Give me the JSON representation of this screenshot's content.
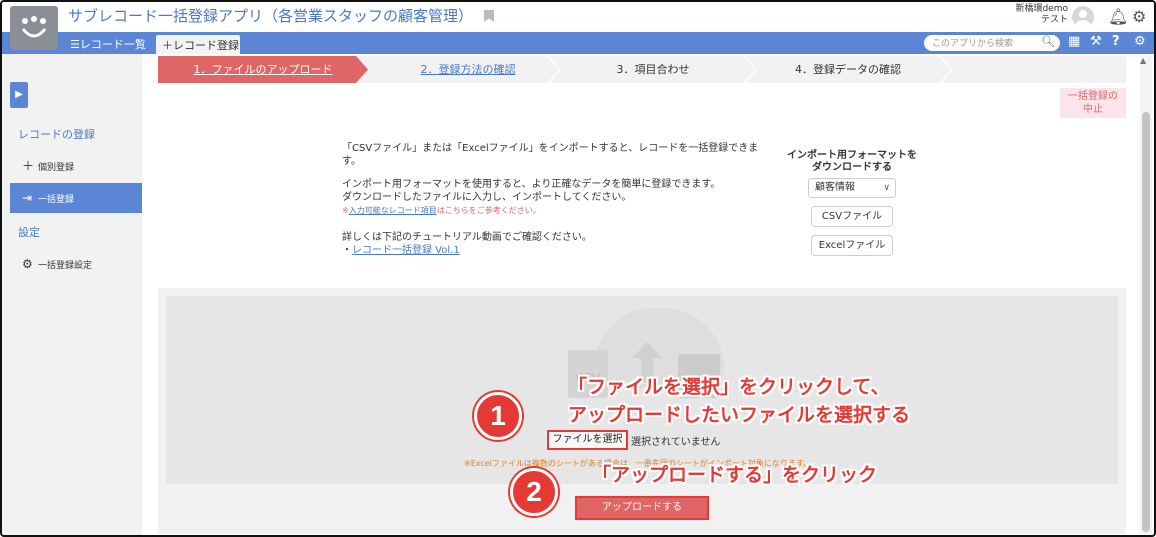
{
  "header": {
    "app_title": "サブレコード一括登録アプリ（各営業スタッフの顧客管理）",
    "user_line1": "新橋環demo",
    "user_line2": "テスト"
  },
  "nav": {
    "record_list": "☰レコード一覧",
    "record_add_tab": "＋レコード登録",
    "search_placeholder": "このアプリから検索"
  },
  "sidebar": {
    "section_register": "レコードの登録",
    "item_individual": "個別登録",
    "item_bulk": "一括登録",
    "section_settings": "設定",
    "item_bulk_settings": "一括登録設定"
  },
  "steps": [
    {
      "label": "1．ファイルのアップロード"
    },
    {
      "label": "2．登録方法の確認"
    },
    {
      "label": "3．項目合わせ"
    },
    {
      "label": "4．登録データの確認"
    }
  ],
  "cancel_label_1": "一括登録の",
  "cancel_label_2": "中止",
  "instructions": {
    "line1": "「CSVファイル」または「Excelファイル」をインポートすると、レコードを一括登録できま",
    "line1b": "す。",
    "line2": "インポート用フォーマットを使用すると、より正確なデータを簡単に登録できます。",
    "line3": "ダウンロードしたファイルに入力し、インポートしてください。",
    "note_link": "入力可能なレコード項目",
    "note_prefix": "※",
    "note_suffix": "はこちらをご参考ください。",
    "line4": "詳しくは下記のチュートリアル動画でご確認ください。",
    "tutorial_prefix": "・",
    "tutorial_link": "レコード一括登録 Vol.1"
  },
  "format": {
    "title1": "インポート用フォーマットを",
    "title2": "ダウンロードする",
    "select_value": "顧客情報",
    "csv_button": "CSVファイル",
    "excel_button": "Excelファイル"
  },
  "upload": {
    "csv_icon_label": "CSV",
    "file_button": "ファイルを選択",
    "file_status": "選択されていません",
    "excel_note": "※Excelファイルは複数のシートがある場合は、一番先頭のシートがインポート対象になります。",
    "upload_button": "アップロードする"
  },
  "annotations": {
    "num1": "1",
    "text1a": "「ファイルを選択」をクリックして、",
    "text1b": "アップロードしたいファイルを選択する",
    "num2": "2",
    "text2": "「アップロードする」をクリック"
  }
}
